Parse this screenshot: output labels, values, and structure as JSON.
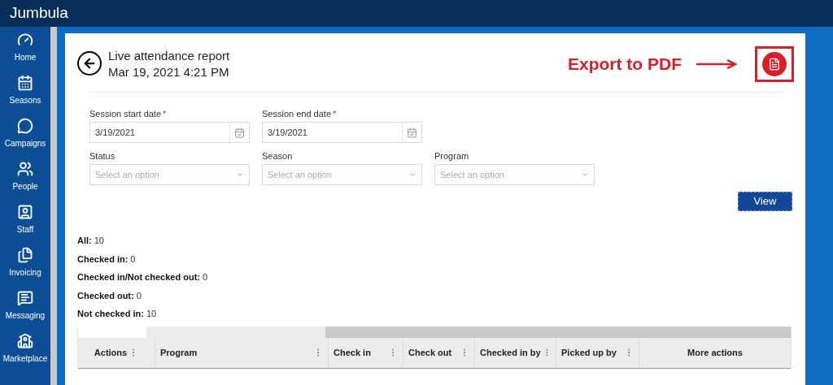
{
  "app": {
    "title": "Jumbula"
  },
  "sidebar": {
    "items": [
      {
        "label": "Home"
      },
      {
        "label": "Seasons"
      },
      {
        "label": "Campaigns"
      },
      {
        "label": "People"
      },
      {
        "label": "Staff"
      },
      {
        "label": "Invoicing"
      },
      {
        "label": "Messaging"
      },
      {
        "label": "Marketplace"
      }
    ]
  },
  "report": {
    "title": "Live attendance report",
    "timestamp": "Mar 19, 2021 4:21 PM"
  },
  "annotation": {
    "text": "Export to PDF"
  },
  "filters": [
    {
      "kind": "date",
      "label": "Session start date",
      "required_mark": "*",
      "value": "3/19/2021"
    },
    {
      "kind": "date",
      "label": "Session end date",
      "required_mark": "*",
      "value": "3/19/2021"
    },
    {
      "kind": "select",
      "label": "Status",
      "placeholder": "Select an option"
    },
    {
      "kind": "select",
      "label": "Season",
      "placeholder": "Select an option"
    },
    {
      "kind": "select",
      "label": "Program",
      "placeholder": "Select an option"
    }
  ],
  "view_button": "View",
  "stats": [
    {
      "label": "All:",
      "value": "10"
    },
    {
      "label": "Checked in:",
      "value": "0"
    },
    {
      "label": "Checked in/Not checked out:",
      "value": "0"
    },
    {
      "label": "Checked out:",
      "value": "0"
    },
    {
      "label": "Not checked in:",
      "value": "10"
    }
  ],
  "table": {
    "columns": [
      {
        "label": "Actions",
        "menu": true
      },
      {
        "label": "Program",
        "menu": true
      },
      {
        "label": "Check in",
        "menu": true
      },
      {
        "label": "Check out",
        "menu": true
      },
      {
        "label": "Checked in by",
        "menu": true
      },
      {
        "label": "Picked up by",
        "menu": true
      },
      {
        "label": "More actions",
        "menu": false
      }
    ]
  }
}
